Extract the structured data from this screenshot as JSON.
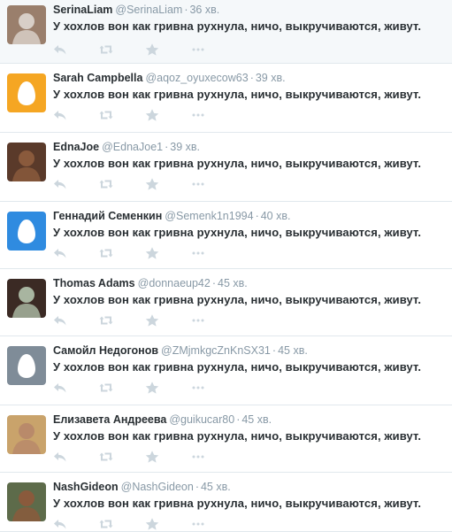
{
  "tweets": [
    {
      "name": "SerinaLiam",
      "handle": "@SerinaLiam",
      "time": "36 хв.",
      "text": "У хохлов вон как гривна рухнула, ничо, выкручиваются, живут.",
      "avatar": "photo-avatar",
      "avatar_color": "#9a7f6c"
    },
    {
      "name": "Sarah Campbella",
      "handle": "@aqoz_oyuxecow63",
      "time": "39 хв.",
      "text": "У хохлов вон как гривна рухнула, ничо, выкручиваются, живут.",
      "avatar": "egg-avatar",
      "avatar_color": "#f5a623"
    },
    {
      "name": "EdnaJoe",
      "handle": "@EdnaJoe1",
      "time": "39 хв.",
      "text": "У хохлов вон как гривна рухнула, ничо, выкручиваются, живут.",
      "avatar": "photo-avatar",
      "avatar_color": "#5a3a2a"
    },
    {
      "name": "Геннадий Семенкин",
      "handle": "@Semenk1n1994",
      "time": "40 хв.",
      "text": "У хохлов вон как гривна рухнула, ничо, выкручиваются, живут.",
      "avatar": "egg-avatar",
      "avatar_color": "#2f8be0"
    },
    {
      "name": "Thomas Adams",
      "handle": "@donnaeup42",
      "time": "45 хв.",
      "text": "У хохлов вон как гривна рухнула, ничо, выкручиваются, живут.",
      "avatar": "photo-avatar",
      "avatar_color": "#3b2a24"
    },
    {
      "name": "Самойл Недогонов",
      "handle": "@ZMjmkgcZnKnSX31",
      "time": "45 хв.",
      "text": "У хохлов вон как гривна рухнула, ничо, выкручиваются, живут.",
      "avatar": "egg-avatar",
      "avatar_color": "#7f8c98"
    },
    {
      "name": "Елизавета Андреева",
      "handle": "@guikucar80",
      "time": "45 хв.",
      "text": "У хохлов вон как гривна рухнула, ничо, выкручиваются, живут.",
      "avatar": "photo-avatar",
      "avatar_color": "#c9a36b"
    },
    {
      "name": "NashGideon",
      "handle": "@NashGideon",
      "time": "45 хв.",
      "text": "У хохлов вон как гривна рухнула, ничо, выкручиваются, живут.",
      "avatar": "photo-avatar",
      "avatar_color": "#5d6b4a"
    }
  ],
  "actions": [
    "reply-icon",
    "retweet-icon",
    "favorite-icon",
    "more-icon"
  ],
  "colors": {
    "muted": "#8899a6",
    "action_icon": "#ccd6dd",
    "divider": "#e1e8ed"
  }
}
